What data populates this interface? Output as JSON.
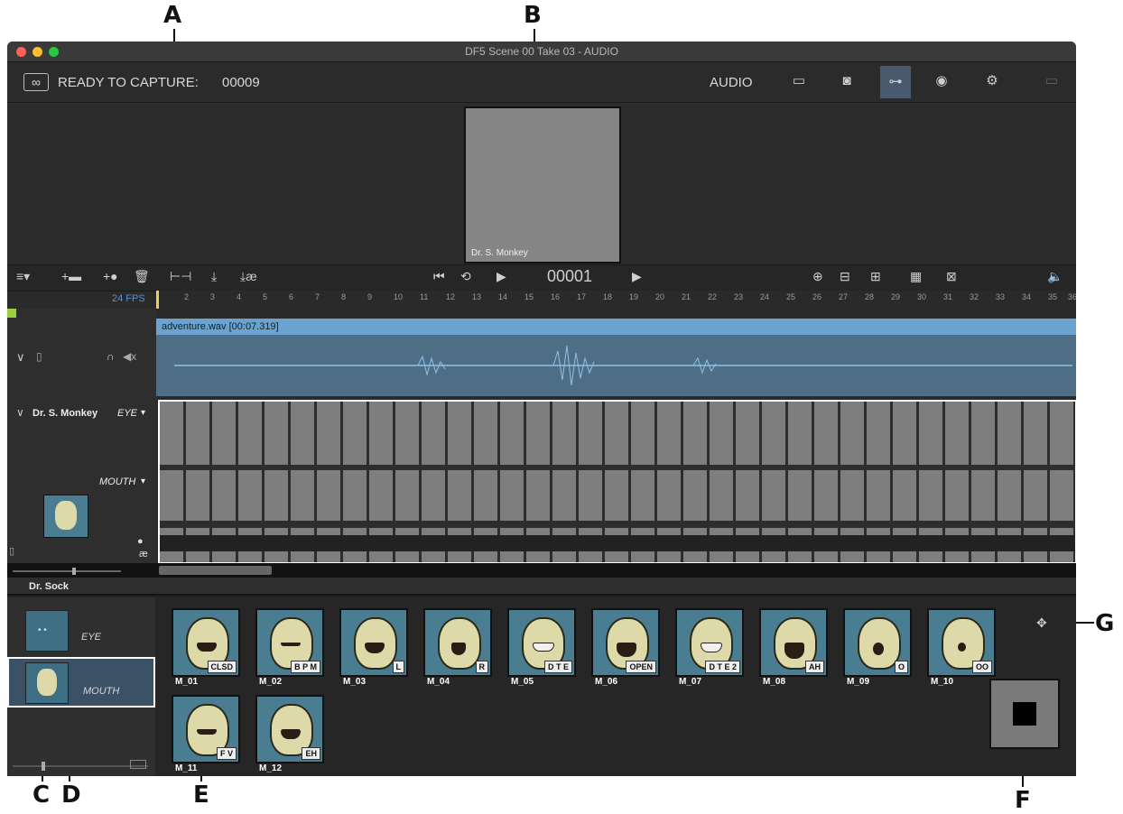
{
  "callouts": [
    "A",
    "B",
    "C",
    "D",
    "E",
    "F",
    "G"
  ],
  "window": {
    "title": "DF5  Scene 00   Take 03 - AUDIO"
  },
  "topbar": {
    "status": "READY TO CAPTURE:",
    "frame": "00009",
    "mode": "AUDIO",
    "mode_icons": [
      "display-icon",
      "camera-icon",
      "audio-waveform-icon",
      "light-icon",
      "settings-cog-icon",
      "split-view-icon"
    ]
  },
  "viewer": {
    "label": "Dr. S. Monkey"
  },
  "transport": {
    "frame": "00001"
  },
  "timeline": {
    "fps": "24 FPS",
    "ticks": [
      "2",
      "3",
      "4",
      "5",
      "6",
      "7",
      "8",
      "9",
      "10",
      "11",
      "12",
      "13",
      "14",
      "15",
      "16",
      "17",
      "18",
      "19",
      "20",
      "21",
      "22",
      "23",
      "24",
      "25",
      "26",
      "27",
      "28",
      "29",
      "30",
      "31",
      "32",
      "33",
      "34",
      "35",
      "36"
    ],
    "audio_clip": "adventure.wav [00:07.319]",
    "track_name": "Dr. S. Monkey",
    "layer_eye": "EYE",
    "layer_mouth": "MOUTH",
    "lipsync_glyph": "æ"
  },
  "dock": {
    "title": "Dr. Sock",
    "sets": [
      {
        "label": "EYE"
      },
      {
        "label": "MOUTH"
      }
    ],
    "phonemes": [
      {
        "name": "M_01",
        "tag": "CLSD"
      },
      {
        "name": "M_02",
        "tag": "B P M"
      },
      {
        "name": "M_03",
        "tag": "L"
      },
      {
        "name": "M_04",
        "tag": "R"
      },
      {
        "name": "M_05",
        "tag": "D T E"
      },
      {
        "name": "M_06",
        "tag": "OPEN"
      },
      {
        "name": "M_07",
        "tag": "D T E 2"
      },
      {
        "name": "M_08",
        "tag": "AH"
      },
      {
        "name": "M_09",
        "tag": "O"
      },
      {
        "name": "M_10",
        "tag": "OO"
      },
      {
        "name": "M_11",
        "tag": "F V"
      },
      {
        "name": "M_12",
        "tag": "EH"
      }
    ]
  },
  "colors": {
    "accent_blue": "#6aa3d0",
    "audio_track": "#4e6e85",
    "thumb_bg": "#4a7d92"
  }
}
